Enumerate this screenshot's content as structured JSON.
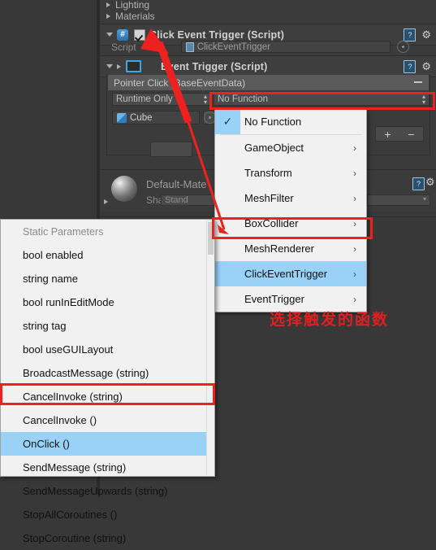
{
  "app": "Unity Editor Inspector",
  "hierarchy": [
    {
      "label": "Lighting",
      "expanded": false
    },
    {
      "label": "Materials",
      "expanded": false
    }
  ],
  "components": [
    {
      "title": "Click Event Trigger (Script)",
      "icon": "csharp-script-icon",
      "enabled_checkbox": true,
      "help_icon": "?",
      "gear_icon": "⚙",
      "fields": [
        {
          "label": "Script",
          "value": "ClickEventTrigger",
          "icon": "script-asset-icon"
        }
      ]
    },
    {
      "title": "Event Trigger (Script)",
      "icon": "event-trigger-icon",
      "help_icon": "?",
      "gear_icon": "⚙"
    }
  ],
  "event_entry": {
    "header": "Pointer Click (BaseEventData)",
    "collapse_glyph": "−",
    "runtime_mode": "Runtime Only",
    "function_value": "No Function",
    "object_value": "Cube",
    "object_icon": "cube-icon",
    "add_button": "+",
    "remove_button": "−"
  },
  "material": {
    "name": "Default-Mate",
    "shader_label": "Shader",
    "shader_value": "Stand",
    "help_icon": "?",
    "gear_icon": "⚙"
  },
  "function_menu": {
    "items": [
      {
        "label": "No Function",
        "checked": true,
        "has_submenu": false,
        "selected": false
      },
      {
        "label": "GameObject",
        "checked": false,
        "has_submenu": true,
        "selected": false
      },
      {
        "label": "Transform",
        "checked": false,
        "has_submenu": true,
        "selected": false
      },
      {
        "label": "MeshFilter",
        "checked": false,
        "has_submenu": true,
        "selected": false
      },
      {
        "label": "BoxCollider",
        "checked": false,
        "has_submenu": true,
        "selected": false
      },
      {
        "label": "MeshRenderer",
        "checked": false,
        "has_submenu": true,
        "selected": false
      },
      {
        "label": "ClickEventTrigger",
        "checked": false,
        "has_submenu": true,
        "selected": true
      },
      {
        "label": "EventTrigger",
        "checked": false,
        "has_submenu": true,
        "selected": false
      }
    ],
    "submenu_arrow": "›",
    "check_glyph": "✓"
  },
  "params_menu": {
    "header": "Static Parameters",
    "items": [
      {
        "label": "bool enabled",
        "selected": false
      },
      {
        "label": "string name",
        "selected": false
      },
      {
        "label": "bool runInEditMode",
        "selected": false
      },
      {
        "label": "string tag",
        "selected": false
      },
      {
        "label": "bool useGUILayout",
        "selected": false
      },
      {
        "label": "BroadcastMessage (string)",
        "selected": false
      },
      {
        "label": "CancelInvoke (string)",
        "selected": false
      },
      {
        "label": "CancelInvoke ()",
        "selected": false
      },
      {
        "label": "OnClick ()",
        "selected": true
      },
      {
        "label": "SendMessage (string)",
        "selected": false
      },
      {
        "label": "SendMessageUpwards (string)",
        "selected": false
      },
      {
        "label": "StopAllCoroutines ()",
        "selected": false
      },
      {
        "label": "StopCoroutine (string)",
        "selected": false
      }
    ]
  },
  "annotation": {
    "note_text": "选择触发的函数",
    "accent_color": "#ef2020",
    "highlight_color": "#99d1f7"
  }
}
